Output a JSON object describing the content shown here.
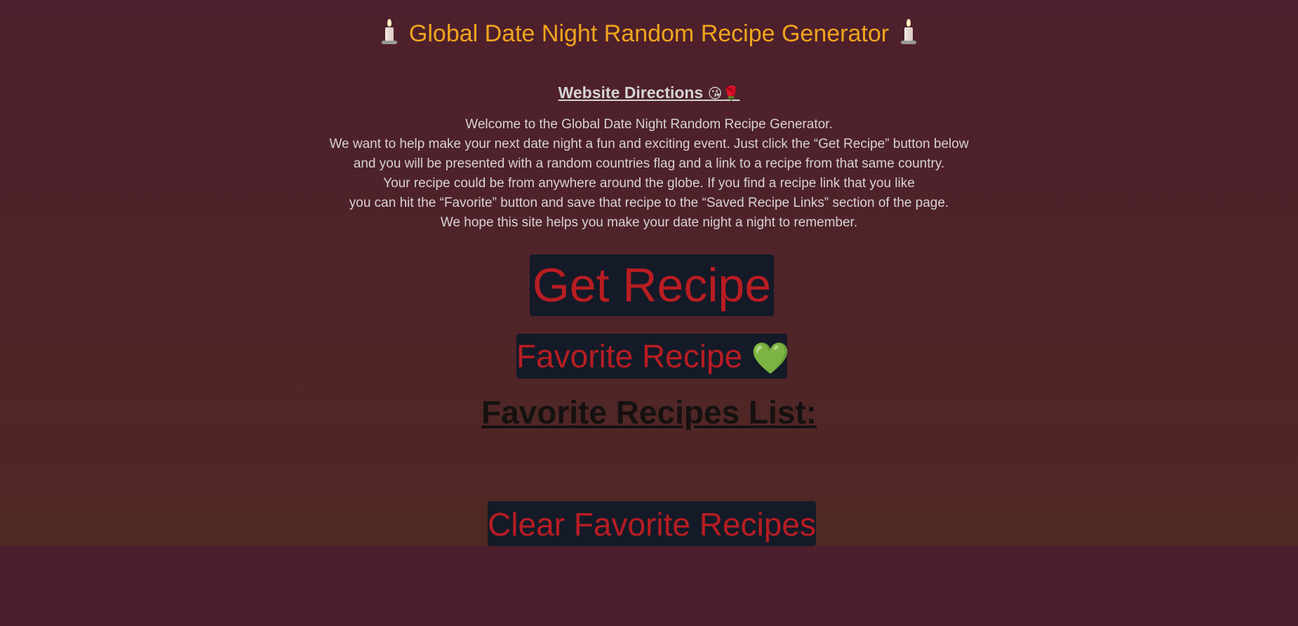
{
  "header": {
    "title": "Global Date Night Random Recipe Generator",
    "left_icon": "candle-icon",
    "right_icon": "candle-icon"
  },
  "directions": {
    "heading": "Website Directions",
    "heading_emoji_1": "😘",
    "heading_emoji_2": "🌹",
    "lines": [
      "Welcome to the Global Date Night Random Recipe Generator.",
      "We want to help make your next date night a fun and exciting event. Just click the “Get Recipe” button below",
      "and you will be presented with a random countries flag and a link to a recipe from that same country.",
      "Your recipe could be from anywhere around the globe. If you find a recipe link that you like",
      "you can hit the “Favorite” button and save that recipe to the “Saved Recipe Links” section of the page.",
      "We hope this site helps you make your date night a night to remember."
    ]
  },
  "buttons": {
    "get_recipe": "Get Recipe",
    "favorite_recipe": "Favorite Recipe",
    "favorite_icon": "💚",
    "clear_favorites": "Clear Favorite Recipes"
  },
  "favorites": {
    "heading": "Favorite Recipes List:",
    "items": []
  },
  "colors": {
    "background": "#4d1f2d",
    "title": "#f1a51e",
    "button_bg": "#141a28",
    "button_text": "#b81d22",
    "text": "#d6d3d3"
  }
}
